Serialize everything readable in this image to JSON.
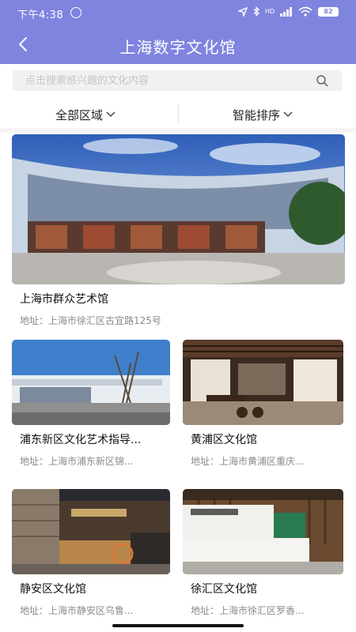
{
  "status_bar": {
    "time": "下午4:38",
    "network": "HD",
    "signal": "4G",
    "battery": "82"
  },
  "header": {
    "title": "上海数字文化馆",
    "back_icon": "chevron-left-icon"
  },
  "search": {
    "placeholder": "点击搜索感兴趣的文化内容",
    "icon": "search-icon"
  },
  "filters": {
    "region_label": "全部区域",
    "sort_label": "智能排序"
  },
  "colors": {
    "header_bg": "#7f84df",
    "text_primary": "#111111",
    "text_secondary": "#8a8a8a"
  },
  "venues": [
    {
      "name": "上海市群众艺术馆",
      "address": "地址：上海市徐汇区古宜路125号"
    },
    {
      "name": "浦东新区文化艺术指导...",
      "address": "地址：上海市浦东新区锦..."
    },
    {
      "name": "黄浦区文化馆",
      "address": "地址：上海市黄浦区重庆..."
    },
    {
      "name": "静安区文化馆",
      "address": "地址：上海市静安区乌鲁..."
    },
    {
      "name": "徐汇区文化馆",
      "address": "地址：上海市徐汇区罗香..."
    }
  ]
}
